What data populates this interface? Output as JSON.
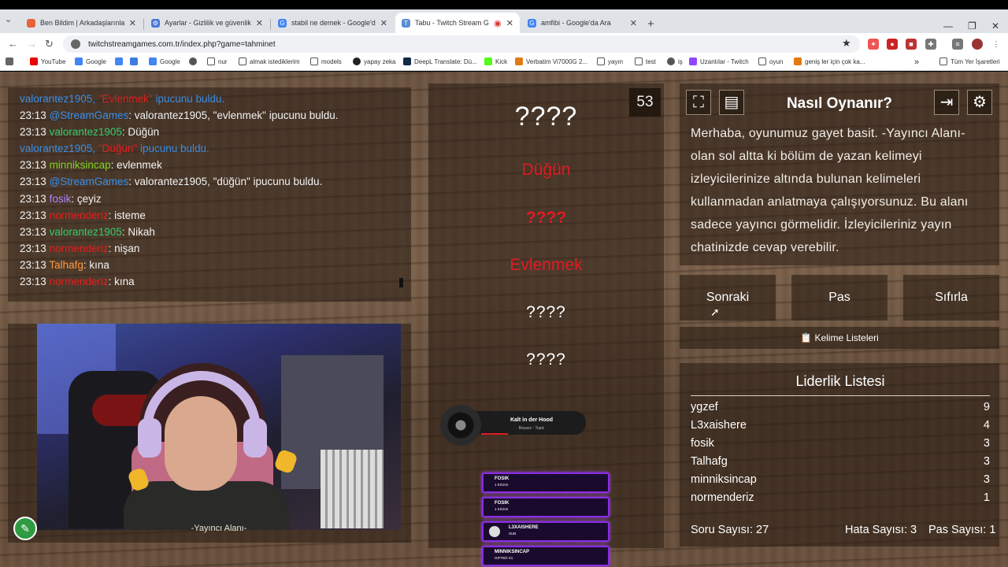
{
  "browser": {
    "tabs": [
      {
        "label": "Ben Bildim | Arkadaşlarınla Onlin",
        "active": false,
        "color": "#e8623a"
      },
      {
        "label": "Ayarlar - Gizlilik ve güvenlik",
        "active": false,
        "color": "#4a77d8"
      },
      {
        "label": "stabil ne demek - Google'da Ara",
        "active": false,
        "color": "#4285f4"
      },
      {
        "label": "Tabu - Twitch Stream Game",
        "active": true,
        "color": "#5b8dd9"
      },
      {
        "label": "amfibi - Google'da Ara",
        "active": false,
        "color": "#4285f4"
      }
    ],
    "url": "twitchstreamgames.com.tr/index.php?game=tahminet",
    "bookmarks": [
      "YouTube",
      "Google",
      "",
      "",
      "Google",
      "",
      "nur",
      "almak istediklerim",
      "models",
      "yapay zeka",
      "DeepL Translate: Dü...",
      "Kick",
      "Verbatim Vi7000G 2...",
      "yayın",
      "test",
      "iş",
      "Uzantılar - Twitch",
      "oyun",
      "geniş ler için çok ka..."
    ],
    "bookmarks_all": "Tüm Yer İşaretleri"
  },
  "chat": {
    "lines": [
      {
        "type": "hint",
        "user": "valorantez1905",
        "word": "\"Evlenmek\"",
        "suffix": " ipucunu buldu."
      },
      {
        "type": "msg",
        "time": "23:13",
        "user": "@StreamGames",
        "ucls": "u-blue",
        "text": ": valorantez1905, \"evlenmek\" ipucunu buldu."
      },
      {
        "type": "msg",
        "time": "23:13",
        "user": "valorantez1905",
        "ucls": "u-green",
        "text": ": Düğün"
      },
      {
        "type": "hint",
        "user": "valorantez1905",
        "word": "\"Düğün\"",
        "suffix": " ipucunu buldu."
      },
      {
        "type": "msg",
        "time": "23:13",
        "user": "minniksincap",
        "ucls": "u-lime",
        "text": ": evlenmek"
      },
      {
        "type": "msg",
        "time": "23:13",
        "user": "@StreamGames",
        "ucls": "u-blue",
        "text": ": valorantez1905, \"düğün\" ipucunu buldu."
      },
      {
        "type": "msg",
        "time": "23:13",
        "user": "fosik",
        "ucls": "u-purple",
        "text": ": çeyiz"
      },
      {
        "type": "msg",
        "time": "23:13",
        "user": "normenderiz",
        "ucls": "u-red",
        "text": ": isteme"
      },
      {
        "type": "msg",
        "time": "23:13",
        "user": "valorantez1905",
        "ucls": "u-green",
        "text": ": Nikah"
      },
      {
        "type": "msg",
        "time": "23:13",
        "user": "normenderiz",
        "ucls": "u-red",
        "text": ": nişan"
      },
      {
        "type": "msg",
        "time": "23:13",
        "user": "Talhafg",
        "ucls": "u-orange",
        "text": ": kına"
      },
      {
        "type": "msg",
        "time": "23:13",
        "user": "normenderiz",
        "ucls": "u-red",
        "text": ": kına"
      }
    ]
  },
  "streamer": {
    "label": "-Yayıncı Alanı-"
  },
  "game": {
    "timer": "53",
    "main_word": "????",
    "clues": [
      "Düğün",
      "????",
      "Evlenmek",
      "????",
      "????"
    ]
  },
  "music": {
    "song": "Kalt in der Hood",
    "artist": "Beyazz - Topic",
    "progress": 0.26
  },
  "alerts": [
    {
      "name": "FOSIK",
      "sub": "1 KICKS"
    },
    {
      "name": "FOSIK",
      "sub": "1 KICKS"
    },
    {
      "name": "L3XAISHERE",
      "sub": "SUB"
    },
    {
      "name": "MINNIKSINCAP",
      "sub": "GIFTED X1"
    }
  ],
  "howto": {
    "title": "Nasıl Oynanır?",
    "text": "Merhaba, oyunumuz gayet basit. -Yayıncı Alanı- olan sol altta ki bölüm de yazan kelimeyi izleyicilerinize altında bulunan kelimeleri kullanmadan anlatmaya çalışıyorsunuz. Bu alanı sadece yayıncı görmelidir. İzleyicileriniz yayın chatinizde cevap verebilir."
  },
  "buttons": {
    "next": "Sonraki",
    "pass": "Pas",
    "reset": "Sıfırla",
    "word_lists": "Kelime Listeleri"
  },
  "leaderboard": {
    "title": "Liderlik Listesi",
    "rows": [
      {
        "name": "ygzef",
        "score": "9"
      },
      {
        "name": "L3xaishere",
        "score": "4"
      },
      {
        "name": "fosik",
        "score": "3"
      },
      {
        "name": "Talhafg",
        "score": "3"
      },
      {
        "name": "minniksincap",
        "score": "3"
      },
      {
        "name": "normenderiz",
        "score": "1"
      }
    ],
    "question_count": "Soru Sayısı: 27",
    "error_count": "Hata Sayısı: 3",
    "pass_count": "Pas Sayısı: 1"
  }
}
